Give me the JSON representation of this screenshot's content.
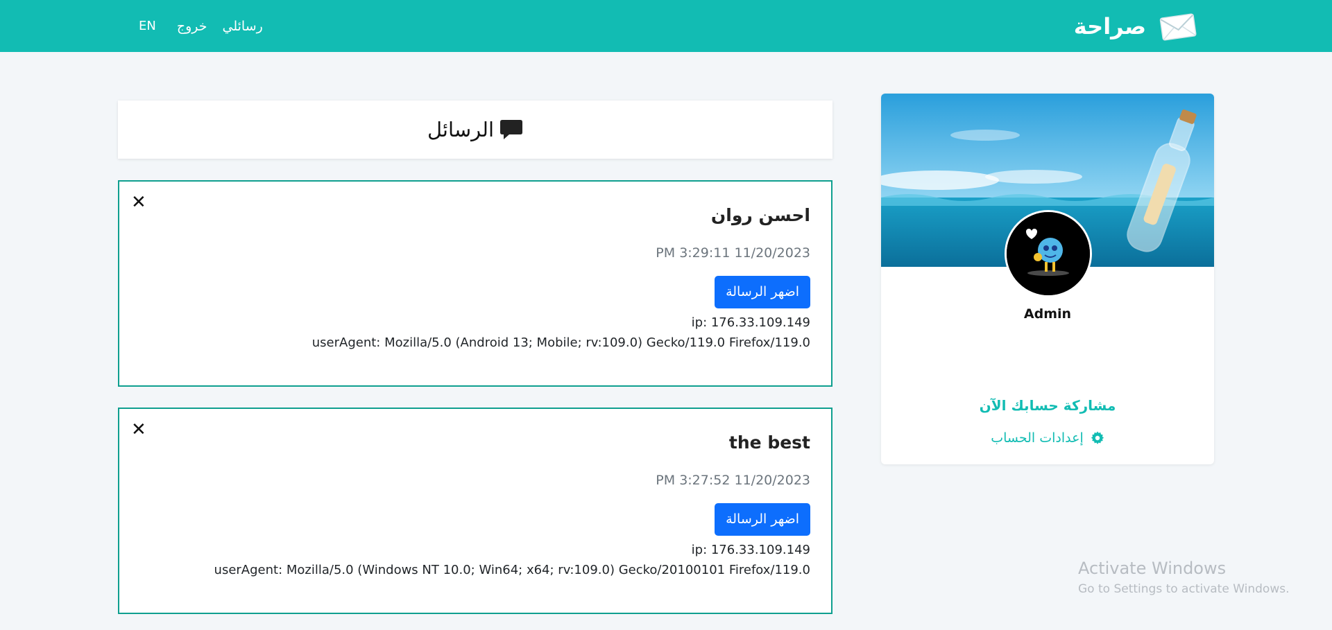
{
  "navbar": {
    "brand": "صراحة",
    "links": {
      "my_messages": "رسائلي",
      "logout": "خروج",
      "language": "EN"
    },
    "bg_color": "#12bcb3"
  },
  "profile": {
    "name": "Admin",
    "share_label": "مشاركة حسابك الآن",
    "settings_label": "إعدادات الحساب",
    "accent_color": "#12bcb3"
  },
  "messages_header": {
    "title": "الرسائل",
    "icon": "chat-bubble-icon"
  },
  "messages": [
    {
      "title": "احسن روان",
      "date": "11/20/2023 3:29:11 PM",
      "button_label": "اضهر الرسالة",
      "ip": "ip: 176.33.109.149",
      "user_agent": "userAgent: Mozilla/5.0 (Android 13; Mobile; rv:109.0) Gecko/119.0 Firefox/119.0"
    },
    {
      "title": "the best",
      "date": "11/20/2023 3:27:52 PM",
      "button_label": "اضهر الرسالة",
      "ip": "ip: 176.33.109.149",
      "user_agent": "userAgent: Mozilla/5.0 (Windows NT 10.0; Win64; x64; rv:109.0) Gecko/20100101 Firefox/119.0"
    }
  ],
  "watermark": {
    "title": "Activate Windows",
    "subtitle": "Go to Settings to activate Windows."
  }
}
